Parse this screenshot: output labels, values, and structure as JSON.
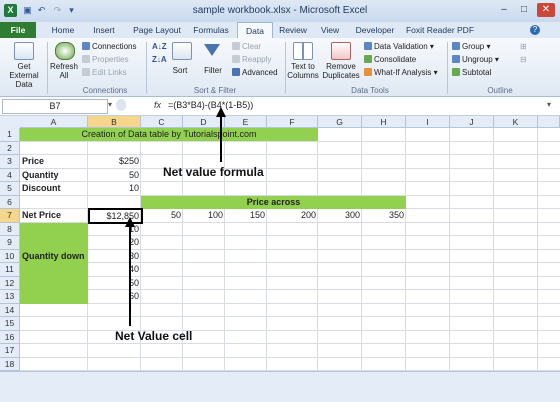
{
  "window": {
    "title": "sample workbook.xlsx - Microsoft Excel",
    "min": "–",
    "max": "□",
    "close": "✕"
  },
  "tabs": [
    "File",
    "Home",
    "Insert",
    "Page Layout",
    "Formulas",
    "Data",
    "Review",
    "View",
    "Developer",
    "Foxit Reader PDF"
  ],
  "ribbon": {
    "get_external": "Get External Data",
    "refresh": "Refresh All",
    "connections": "Connections",
    "properties": "Properties",
    "edit_links": "Edit Links",
    "sort": "Sort",
    "filter": "Filter",
    "clear": "Clear",
    "reapply": "Reapply",
    "advanced": "Advanced",
    "text_to_columns": "Text to Columns",
    "remove_duplicates": "Remove Duplicates",
    "data_validation": "Data Validation",
    "consolidate": "Consolidate",
    "what_if": "What-If Analysis",
    "group": "Group",
    "ungroup": "Ungroup",
    "subtotal": "Subtotal",
    "groups": {
      "connections": "Connections",
      "sort_filter": "Sort & Filter",
      "data_tools": "Data Tools",
      "outline": "Outline"
    }
  },
  "formula_bar": {
    "name_box": "B7",
    "fx": "fx",
    "formula": "=(B3*B4)-(B4*(1-B5))"
  },
  "columns": [
    "A",
    "B",
    "C",
    "D",
    "E",
    "F",
    "G",
    "H",
    "I",
    "J",
    "K"
  ],
  "rows": [
    "1",
    "2",
    "3",
    "4",
    "5",
    "6",
    "7",
    "8",
    "9",
    "10",
    "11",
    "12",
    "13",
    "14",
    "15",
    "16",
    "17",
    "18"
  ],
  "cells": {
    "title": "Creation of Data table by Tutorialspoint.com",
    "price_label": "Price",
    "price_value": "$250",
    "quantity_label": "Quantity",
    "quantity_value": "50",
    "discount_label": "Discount",
    "discount_value": "10",
    "price_across": "Price across",
    "net_price_label": "Net Price",
    "net_price_value": "$12,850",
    "prices": [
      "50",
      "100",
      "150",
      "200",
      "300",
      "350"
    ],
    "quantity_down": "Quantity down",
    "quantities": [
      "10",
      "20",
      "30",
      "40",
      "50",
      "60"
    ]
  },
  "annotations": {
    "net_value_formula": "Net value formula",
    "net_value_cell": "Net Value cell"
  },
  "colors": {
    "highlight": "#92d050",
    "file_tab": "#2e7d32"
  }
}
